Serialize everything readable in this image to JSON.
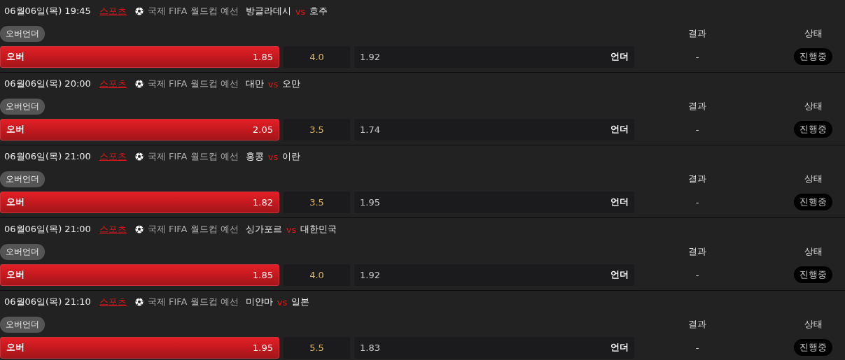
{
  "matches": [
    {
      "datetime": "06월06일(목) 19:45",
      "category": "스포츠",
      "league": "국제 FIFA 월드컵 예선",
      "home": "방글라데시",
      "vs": "vs",
      "away": "호주",
      "market": "오버언더",
      "result_header": "결과",
      "status_header": "상태",
      "over": {
        "label": "오버",
        "odds": "1.85",
        "selected": true
      },
      "line": "4.0",
      "under": {
        "label": "언더",
        "odds": "1.92",
        "selected": false
      },
      "result": "-",
      "status": "진행중"
    },
    {
      "datetime": "06월06일(목) 20:00",
      "category": "스포츠",
      "league": "국제 FIFA 월드컵 예선",
      "home": "대만",
      "vs": "vs",
      "away": "오만",
      "market": "오버언더",
      "result_header": "결과",
      "status_header": "상태",
      "over": {
        "label": "오버",
        "odds": "2.05",
        "selected": true
      },
      "line": "3.5",
      "under": {
        "label": "언더",
        "odds": "1.74",
        "selected": false
      },
      "result": "-",
      "status": "진행중"
    },
    {
      "datetime": "06월06일(목) 21:00",
      "category": "스포츠",
      "league": "국제 FIFA 월드컵 예선",
      "home": "홍콩",
      "vs": "vs",
      "away": "이란",
      "market": "오버언더",
      "result_header": "결과",
      "status_header": "상태",
      "over": {
        "label": "오버",
        "odds": "1.82",
        "selected": true
      },
      "line": "3.5",
      "under": {
        "label": "언더",
        "odds": "1.95",
        "selected": false
      },
      "result": "-",
      "status": "진행중"
    },
    {
      "datetime": "06월06일(목) 21:00",
      "category": "스포츠",
      "league": "국제 FIFA 월드컵 예선",
      "home": "싱가포르",
      "vs": "vs",
      "away": "대한민국",
      "market": "오버언더",
      "result_header": "결과",
      "status_header": "상태",
      "over": {
        "label": "오버",
        "odds": "1.85",
        "selected": true
      },
      "line": "4.0",
      "under": {
        "label": "언더",
        "odds": "1.92",
        "selected": false
      },
      "result": "-",
      "status": "진행중"
    },
    {
      "datetime": "06월06일(목) 21:10",
      "category": "스포츠",
      "league": "국제 FIFA 월드컵 예선",
      "home": "미얀마",
      "vs": "vs",
      "away": "일본",
      "market": "오버언더",
      "result_header": "결과",
      "status_header": "상태",
      "over": {
        "label": "오버",
        "odds": "1.95",
        "selected": true
      },
      "line": "5.5",
      "under": {
        "label": "언더",
        "odds": "1.83",
        "selected": false
      },
      "result": "-",
      "status": "진행중"
    }
  ]
}
